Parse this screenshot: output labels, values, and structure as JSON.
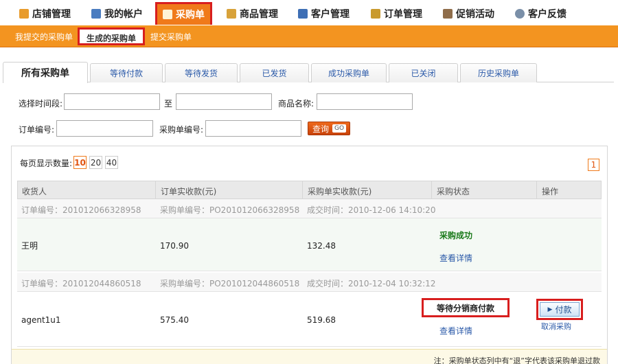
{
  "topnav": {
    "items": [
      {
        "label": "店铺管理",
        "icon": "house-icon"
      },
      {
        "label": "我的帐户",
        "icon": "account-icon"
      },
      {
        "label": "采购单",
        "icon": "purchase-order-icon"
      },
      {
        "label": "商品管理",
        "icon": "goods-icon"
      },
      {
        "label": "客户管理",
        "icon": "customer-icon"
      },
      {
        "label": "订单管理",
        "icon": "order-icon"
      },
      {
        "label": "促销活动",
        "icon": "promotion-icon"
      },
      {
        "label": "客户反馈",
        "icon": "feedback-icon"
      }
    ]
  },
  "subnav": {
    "items": [
      "我提交的采购单",
      "生成的采购单",
      "提交采购单"
    ]
  },
  "tabs": [
    "所有采购单",
    "等待付款",
    "等待发货",
    "已发货",
    "成功采购单",
    "已关闭",
    "历史采购单"
  ],
  "search": {
    "time_label": "选择时间段:",
    "to_label": "至",
    "product_label": "商品名称:",
    "order_no_label": "订单编号:",
    "po_no_label": "采购单编号:",
    "query_label": "查询",
    "go_label": "GO"
  },
  "results": {
    "perpage_label": "每页显示数量:",
    "perpage_options": [
      "10",
      "20",
      "40"
    ],
    "page": "1",
    "headers": [
      "收货人",
      "订单实收款(元)",
      "采购单实收款(元)",
      "采购状态",
      "操作"
    ],
    "rows": [
      {
        "order_no": "订单编号：201012066328958",
        "po_no": "采购单编号：PO201012066328958",
        "deal_time": "成交时间：2010-12-06 14:10:20",
        "receiver": "王明",
        "order_amount": "170.90",
        "po_amount": "132.48",
        "status": "采购成功",
        "detail": "查看详情"
      },
      {
        "order_no": "订单编号：201012044860518",
        "po_no": "采购单编号：PO201012044860518",
        "deal_time": "成交时间：2010-12-04 10:32:12",
        "receiver": "agent1u1",
        "order_amount": "575.40",
        "po_amount": "519.68",
        "status": "等待分销商付款",
        "detail": "查看详情",
        "pay_label": "付款",
        "cancel_label": "取消采购"
      }
    ],
    "note": "注：采购单状态列中有“退”字代表该采购单退过款"
  }
}
